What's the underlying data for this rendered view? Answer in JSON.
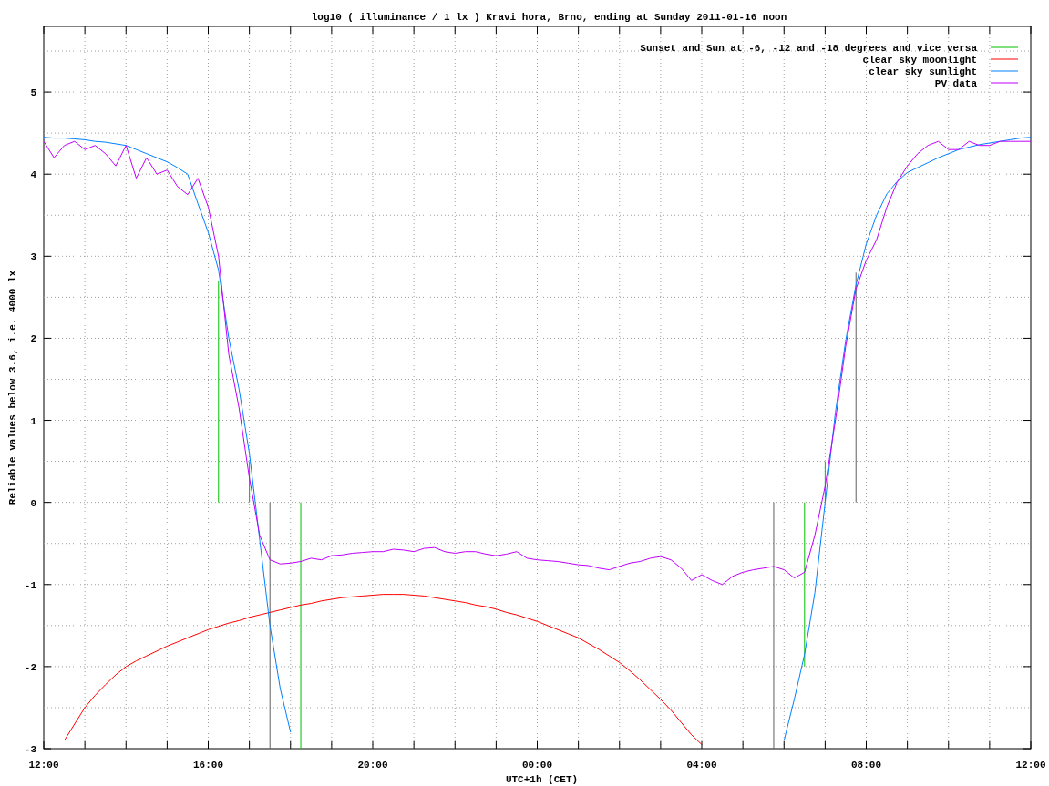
{
  "chart": {
    "chart_data": {
      "type": "line",
      "title": "log10 ( illuminance / 1 lx ) Kravi hora, Brno, ending at Sunday 2011-01-16 noon",
      "xlabel": "UTC+1h (CET)",
      "ylabel": "Reliable values below 3.6, i.e. 4000 lx",
      "ylim": [
        -3,
        5.8
      ],
      "categories": [
        "12:00",
        null,
        null,
        null,
        null,
        null,
        null,
        null,
        null,
        null,
        null,
        null,
        null,
        null,
        null,
        null,
        "16:00",
        null,
        null,
        null,
        null,
        null,
        null,
        null,
        null,
        null,
        null,
        null,
        null,
        null,
        null,
        null,
        "20:00",
        null,
        null,
        null,
        null,
        null,
        null,
        null,
        null,
        null,
        null,
        null,
        null,
        null,
        null,
        null,
        "00:00",
        null,
        null,
        null,
        null,
        null,
        null,
        null,
        null,
        null,
        null,
        null,
        null,
        null,
        null,
        null,
        "04:00",
        null,
        null,
        null,
        null,
        null,
        null,
        null,
        null,
        null,
        null,
        null,
        null,
        null,
        null,
        null,
        "08:00",
        null,
        null,
        null,
        null,
        null,
        null,
        null,
        null,
        null,
        null,
        null,
        null,
        null,
        null,
        null,
        "12:00"
      ],
      "yticks": [
        -3,
        -2,
        -1,
        0,
        1,
        2,
        3,
        4,
        5
      ],
      "grid": true,
      "legend": true,
      "series": [
        {
          "name": "Sunset and Sun at -6, -12 and -18 degrees and vice versa",
          "color": "#00c000",
          "type": "bar",
          "values": [
            null,
            null,
            null,
            null,
            null,
            null,
            null,
            null,
            null,
            null,
            null,
            null,
            null,
            null,
            null,
            null,
            null,
            2.7,
            null,
            null,
            0.5,
            null,
            null,
            null,
            null,
            -3,
            null,
            null,
            null,
            null,
            null,
            null,
            null,
            null,
            null,
            null,
            null,
            null,
            null,
            null,
            null,
            null,
            null,
            null,
            null,
            null,
            null,
            null,
            null,
            null,
            null,
            null,
            null,
            null,
            null,
            null,
            null,
            null,
            null,
            null,
            null,
            null,
            null,
            null,
            null,
            null,
            null,
            null,
            null,
            null,
            null,
            null,
            null,
            null,
            -2,
            null,
            0.5,
            null,
            null,
            null,
            null,
            null,
            null,
            null,
            null,
            null,
            null,
            null,
            null,
            null,
            null,
            null,
            null,
            null,
            null,
            null,
            null
          ]
        },
        {
          "name": "clear sky moonlight",
          "color": "#ff0000",
          "type": "line",
          "values": [
            null,
            null,
            -2.9,
            -2.7,
            -2.5,
            -2.35,
            -2.22,
            -2.1,
            -2.0,
            -1.93,
            -1.87,
            -1.81,
            -1.75,
            -1.7,
            -1.65,
            -1.6,
            -1.55,
            -1.51,
            -1.47,
            -1.44,
            -1.4,
            -1.37,
            -1.34,
            -1.31,
            -1.28,
            -1.25,
            -1.23,
            -1.2,
            -1.18,
            -1.16,
            -1.15,
            -1.14,
            -1.13,
            -1.12,
            -1.12,
            -1.12,
            -1.13,
            -1.14,
            -1.16,
            -1.18,
            -1.2,
            -1.22,
            -1.25,
            -1.27,
            -1.3,
            -1.34,
            -1.37,
            -1.41,
            -1.45,
            -1.5,
            -1.55,
            -1.6,
            -1.65,
            -1.72,
            -1.79,
            -1.87,
            -1.95,
            -2.05,
            -2.16,
            -2.28,
            -2.4,
            -2.53,
            -2.68,
            -2.83,
            -2.95,
            null,
            null,
            null,
            null,
            null,
            null,
            null,
            null,
            null,
            null,
            null,
            null,
            null,
            null,
            null,
            null,
            null,
            null,
            null,
            null,
            null,
            null,
            null,
            null,
            null,
            null,
            null,
            null,
            null,
            null,
            null,
            null
          ]
        },
        {
          "name": "clear sky sunlight",
          "color": "#0080ff",
          "type": "line",
          "values": [
            4.45,
            4.44,
            4.44,
            4.43,
            4.42,
            4.4,
            4.39,
            4.37,
            4.35,
            4.3,
            4.25,
            4.2,
            4.15,
            4.08,
            4.0,
            3.64,
            3.29,
            2.83,
            2.0,
            1.38,
            0.6,
            -0.45,
            -1.5,
            -2.27,
            -2.8,
            null,
            null,
            null,
            null,
            null,
            null,
            null,
            null,
            null,
            null,
            null,
            null,
            null,
            null,
            null,
            null,
            null,
            null,
            null,
            null,
            null,
            null,
            null,
            null,
            null,
            null,
            null,
            null,
            null,
            null,
            null,
            null,
            null,
            null,
            null,
            null,
            null,
            null,
            null,
            null,
            null,
            null,
            null,
            null,
            null,
            null,
            null,
            -2.9,
            -2.4,
            -1.85,
            -1.1,
            0,
            1.1,
            1.97,
            2.65,
            3.15,
            3.5,
            3.76,
            3.91,
            4.02,
            4.08,
            4.14,
            4.2,
            4.25,
            4.3,
            4.33,
            4.36,
            4.38,
            4.4,
            4.42,
            4.44,
            4.45
          ]
        },
        {
          "name": "PV data",
          "color": "#c000ff",
          "type": "line",
          "values": [
            4.4,
            4.2,
            4.35,
            4.4,
            4.3,
            4.35,
            4.25,
            4.1,
            4.35,
            3.95,
            4.2,
            4.0,
            4.05,
            3.85,
            3.75,
            3.95,
            3.6,
            3.0,
            1.8,
            1.15,
            0.3,
            -0.4,
            -0.7,
            -0.75,
            -0.74,
            -0.72,
            -0.68,
            -0.7,
            -0.65,
            -0.64,
            -0.62,
            -0.61,
            -0.6,
            -0.6,
            -0.57,
            -0.58,
            -0.6,
            -0.56,
            -0.55,
            -0.6,
            -0.62,
            -0.6,
            -0.6,
            -0.63,
            -0.65,
            -0.63,
            -0.6,
            -0.68,
            -0.7,
            -0.71,
            -0.72,
            -0.74,
            -0.76,
            -0.77,
            -0.8,
            -0.82,
            -0.78,
            -0.74,
            -0.72,
            -0.68,
            -0.66,
            -0.7,
            -0.8,
            -0.95,
            -0.88,
            -0.95,
            -1.0,
            -0.9,
            -0.85,
            -0.82,
            -0.8,
            -0.78,
            -0.82,
            -0.92,
            -0.85,
            -0.4,
            0.2,
            1.0,
            1.9,
            2.6,
            2.95,
            3.2,
            3.6,
            3.9,
            4.1,
            4.25,
            4.35,
            4.4,
            4.3,
            4.3,
            4.4,
            4.35,
            4.35,
            4.4,
            4.4,
            4.4,
            4.4
          ]
        },
        {
          "color": "#606060",
          "type": "bar",
          "values": [
            null,
            null,
            null,
            null,
            null,
            null,
            null,
            null,
            null,
            null,
            null,
            null,
            null,
            null,
            null,
            null,
            null,
            null,
            null,
            null,
            null,
            null,
            -3,
            null,
            null,
            null,
            null,
            null,
            null,
            null,
            null,
            null,
            null,
            null,
            null,
            null,
            null,
            null,
            null,
            null,
            null,
            null,
            null,
            null,
            null,
            null,
            null,
            null,
            null,
            null,
            null,
            null,
            null,
            null,
            null,
            null,
            null,
            null,
            null,
            null,
            null,
            null,
            null,
            null,
            null,
            null,
            null,
            null,
            null,
            null,
            null,
            -3,
            null,
            null,
            null,
            null,
            null,
            null,
            null,
            2.8,
            null,
            null,
            null,
            null,
            null,
            null,
            null,
            null,
            null,
            null,
            null,
            null,
            null,
            null,
            null,
            null,
            null
          ]
        }
      ]
    }
  }
}
